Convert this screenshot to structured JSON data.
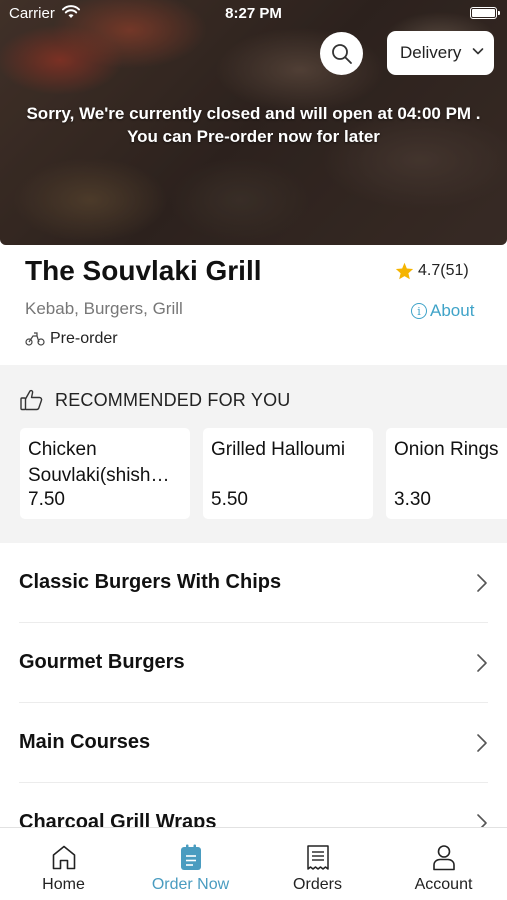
{
  "status_bar": {
    "carrier": "Carrier",
    "time": "8:27 PM"
  },
  "header": {
    "delivery_label": "Delivery",
    "closed_line1": "Sorry, We're currently closed and will open at 04:00 PM .",
    "closed_line2": "You can Pre-order now for later"
  },
  "restaurant": {
    "name": "The Souvlaki Grill",
    "rating": "4.7(51)",
    "cuisine": "Kebab, Burgers, Grill",
    "about_label": "About",
    "preorder_label": "Pre-order"
  },
  "recommended": {
    "title": "RECOMMENDED FOR YOU",
    "items": [
      {
        "name": "Chicken Souvlaki(shish kebab)",
        "price": "7.50"
      },
      {
        "name": "Grilled Halloumi",
        "price": "5.50"
      },
      {
        "name": "Onion Rings",
        "price": "3.30"
      }
    ]
  },
  "categories": [
    {
      "label": "Classic Burgers With Chips"
    },
    {
      "label": "Gourmet Burgers"
    },
    {
      "label": "Main Courses"
    },
    {
      "label": "Charcoal Grill Wraps"
    }
  ],
  "tabs": [
    {
      "label": "Home",
      "icon": "home-icon"
    },
    {
      "label": "Order Now",
      "icon": "order-icon"
    },
    {
      "label": "Orders",
      "icon": "receipt-icon"
    },
    {
      "label": "Account",
      "icon": "person-icon"
    }
  ],
  "colors": {
    "accent": "#4a9cc0",
    "link": "#3fa3c8",
    "star": "#f5b400"
  }
}
